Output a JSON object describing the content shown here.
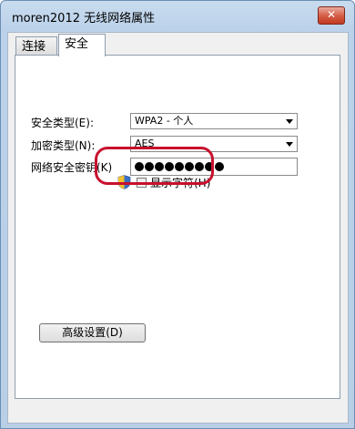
{
  "window": {
    "title": "moren2012 无线网络属性",
    "close_symbol": "✕"
  },
  "tabs": [
    {
      "label": "连接"
    },
    {
      "label": "安全"
    }
  ],
  "security": {
    "type_label": "安全类型(E):",
    "type_value": "WPA2 - 个人",
    "encryption_label": "加密类型(N):",
    "encryption_value": "AES",
    "key_label": "网络安全密钥(K)",
    "key_dot_count": 9,
    "show_chars_label": "显示字符(H)",
    "advanced_button": "高级设置(D)"
  },
  "colors": {
    "highlight_ring": "#c8102e",
    "title_bar": "#bcd2ea"
  }
}
